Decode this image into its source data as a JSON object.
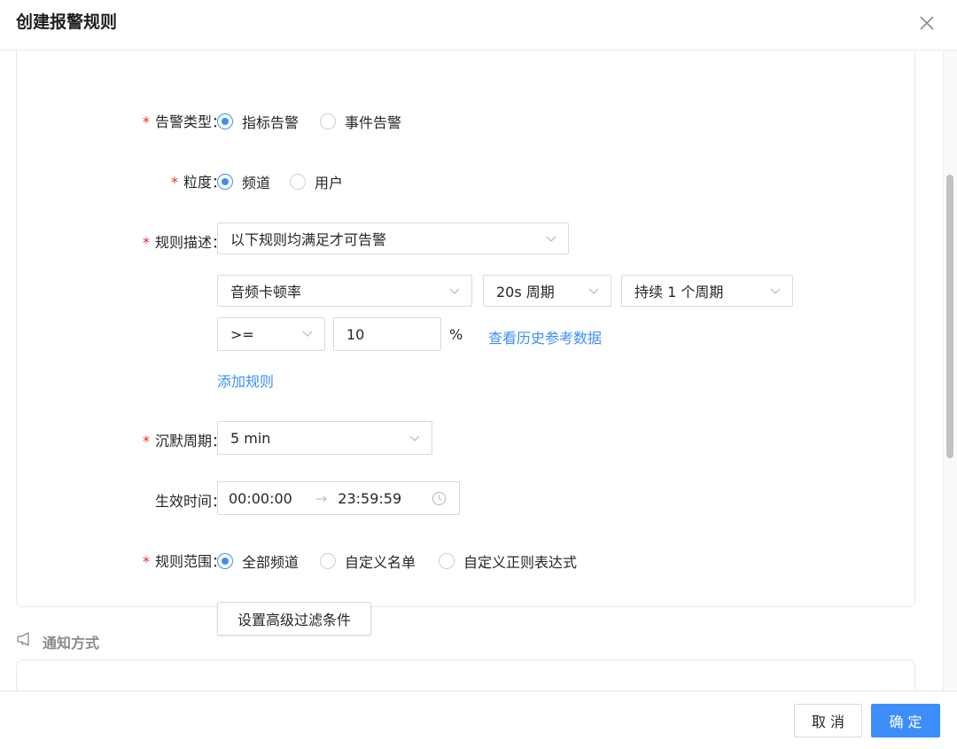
{
  "dialog": {
    "title": "创建报警规则"
  },
  "form": {
    "alert_type": {
      "label": "告警类型：",
      "options": [
        "指标告警",
        "事件告警"
      ],
      "selected": "指标告警"
    },
    "granularity": {
      "label": "粒度：",
      "options": [
        "频道",
        "用户"
      ],
      "selected": "频道"
    },
    "rule_desc": {
      "label": "规则描述：",
      "mode": "以下规则均满足才可告警",
      "metric": "音频卡顿率",
      "period": "20s 周期",
      "duration": "持续 1 个周期",
      "operator": ">=",
      "threshold": "10",
      "unit": "%",
      "history_link": "查看历史参考数据",
      "add_rule": "添加规则"
    },
    "silence": {
      "label": "沉默周期：",
      "value": "5 min"
    },
    "effective_time": {
      "label": "生效时间：",
      "start": "00:00:00",
      "arrow": "→",
      "end": "23:59:59"
    },
    "scope": {
      "label": "规则范围：",
      "options": [
        "全部频道",
        "自定义名单",
        "自定义正则表达式"
      ],
      "selected": "全部频道"
    },
    "advanced_filter_button": "设置高级过滤条件"
  },
  "notify_section": {
    "title": "通知方式"
  },
  "footer": {
    "cancel": "取 消",
    "ok": "确 定"
  },
  "colors": {
    "primary": "#3d8ef8",
    "required": "#f5222d"
  }
}
